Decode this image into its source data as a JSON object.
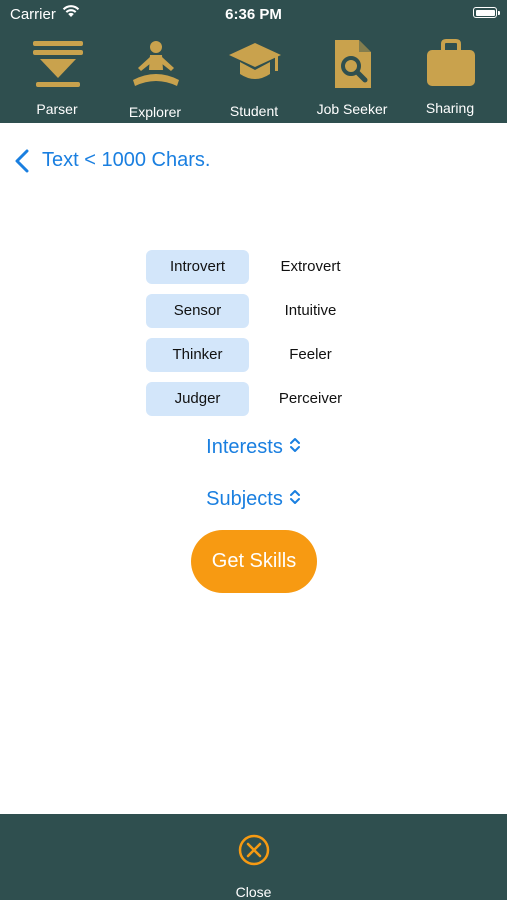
{
  "status_bar": {
    "carrier": "Carrier",
    "time": "6:36 PM"
  },
  "tabs": [
    {
      "label": "Parser",
      "icon": "parser-icon"
    },
    {
      "label": "Explorer",
      "icon": "meditation-icon"
    },
    {
      "label": "Student",
      "icon": "graduation-cap-icon"
    },
    {
      "label": "Job Seeker",
      "icon": "document-search-icon"
    },
    {
      "label": "Sharing",
      "icon": "briefcase-icon"
    }
  ],
  "nav": {
    "back_label": "Text < 1000 Chars."
  },
  "traits": [
    {
      "selected": "Introvert",
      "other": "Extrovert"
    },
    {
      "selected": "Sensor",
      "other": "Intuitive"
    },
    {
      "selected": "Thinker",
      "other": "Feeler"
    },
    {
      "selected": "Judger",
      "other": "Perceiver"
    }
  ],
  "pickers": {
    "interests": "Interests",
    "subjects": "Subjects"
  },
  "action": {
    "label": "Get Skills"
  },
  "footer": {
    "close_label": "Close"
  },
  "colors": {
    "bar_background": "#2f4f4f",
    "icon_gold": "#c9a24d",
    "accent_blue": "#1a7fe0",
    "selected_bg": "#d3e6fa",
    "cta_orange": "#f79a12"
  }
}
